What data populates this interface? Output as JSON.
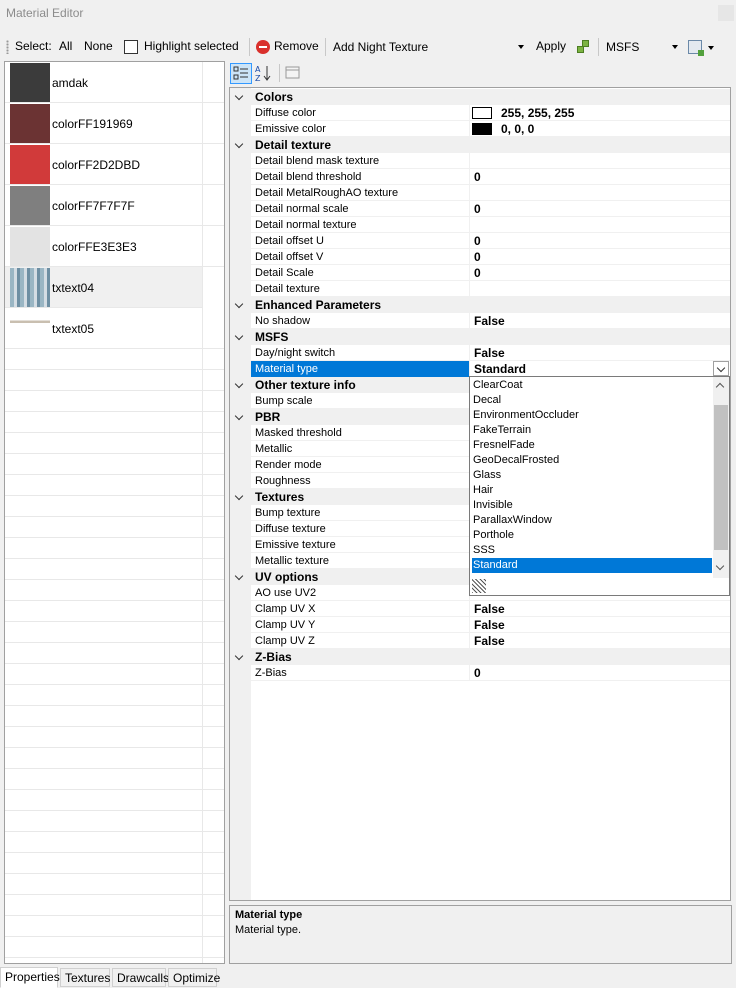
{
  "window": {
    "title": "Material Editor"
  },
  "toolbar": {
    "select_label": "Select:",
    "all_label": "All",
    "none_label": "None",
    "highlight_label": "Highlight selected",
    "remove_label": "Remove",
    "night_texture_value": "Add Night Texture",
    "apply_label": "Apply",
    "platform_value": "MSFS"
  },
  "materials": [
    {
      "name": "amdak",
      "color": "#3b3b3b"
    },
    {
      "name": "colorFF191969",
      "color": "#6b3333"
    },
    {
      "name": "colorFF2D2DBD",
      "color": "#d13a3a"
    },
    {
      "name": "colorFF7F7F7F",
      "color": "#7f7f7f"
    },
    {
      "name": "colorFFE3E3E3",
      "color": "#e3e3e3"
    },
    {
      "name": "txtext04",
      "color": "texture",
      "selected": true
    },
    {
      "name": "txtext05",
      "color": "texture"
    }
  ],
  "grid": {
    "categories": [
      {
        "label": "Colors",
        "props": [
          {
            "name": "Diffuse color",
            "value": "255, 255, 255",
            "swatch": "#ffffff"
          },
          {
            "name": "Emissive color",
            "value": "0, 0, 0",
            "swatch": "#000000"
          }
        ]
      },
      {
        "label": "Detail texture",
        "props": [
          {
            "name": "Detail blend mask texture",
            "value": ""
          },
          {
            "name": "Detail blend threshold",
            "value": "0"
          },
          {
            "name": "Detail MetalRoughAO texture",
            "value": ""
          },
          {
            "name": "Detail normal scale",
            "value": "0"
          },
          {
            "name": "Detail normal texture",
            "value": ""
          },
          {
            "name": "Detail offset U",
            "value": "0"
          },
          {
            "name": "Detail offset V",
            "value": "0"
          },
          {
            "name": "Detail Scale",
            "value": "0"
          },
          {
            "name": "Detail texture",
            "value": ""
          }
        ]
      },
      {
        "label": "Enhanced Parameters",
        "props": [
          {
            "name": "No shadow",
            "value": "False"
          }
        ]
      },
      {
        "label": "MSFS",
        "props": [
          {
            "name": "Day/night switch",
            "value": "False"
          },
          {
            "name": "Material type",
            "value": "Standard",
            "selected": true
          }
        ]
      },
      {
        "label": "Other texture info",
        "props": [
          {
            "name": "Bump scale",
            "value": ""
          }
        ]
      },
      {
        "label": "PBR",
        "props": [
          {
            "name": "Masked threshold",
            "value": ""
          },
          {
            "name": "Metallic",
            "value": ""
          },
          {
            "name": "Render mode",
            "value": ""
          },
          {
            "name": "Roughness",
            "value": ""
          }
        ]
      },
      {
        "label": "Textures",
        "props": [
          {
            "name": "Bump texture",
            "value": ""
          },
          {
            "name": "Diffuse texture",
            "value": ""
          },
          {
            "name": "Emissive texture",
            "value": ""
          },
          {
            "name": "Metallic texture",
            "value": ""
          }
        ]
      },
      {
        "label": "UV options",
        "props": [
          {
            "name": "AO use UV2",
            "value": ""
          },
          {
            "name": "Clamp UV X",
            "value": "False"
          },
          {
            "name": "Clamp UV Y",
            "value": "False"
          },
          {
            "name": "Clamp UV Z",
            "value": "False"
          }
        ]
      },
      {
        "label": "Z-Bias",
        "props": [
          {
            "name": "Z-Bias",
            "value": "0"
          }
        ]
      }
    ]
  },
  "material_type_options": [
    "ClearCoat",
    "Decal",
    "EnvironmentOccluder",
    "FakeTerrain",
    "FresnelFade",
    "GeoDecalFrosted",
    "Glass",
    "Hair",
    "Invisible",
    "ParallaxWindow",
    "Porthole",
    "SSS",
    "Standard"
  ],
  "material_type_selected": "Standard",
  "help": {
    "title": "Material type",
    "description": "Material type."
  },
  "tabs": [
    {
      "label": "Properties",
      "active": true
    },
    {
      "label": "Textures"
    },
    {
      "label": "Drawcalls"
    },
    {
      "label": "Optimize"
    }
  ]
}
